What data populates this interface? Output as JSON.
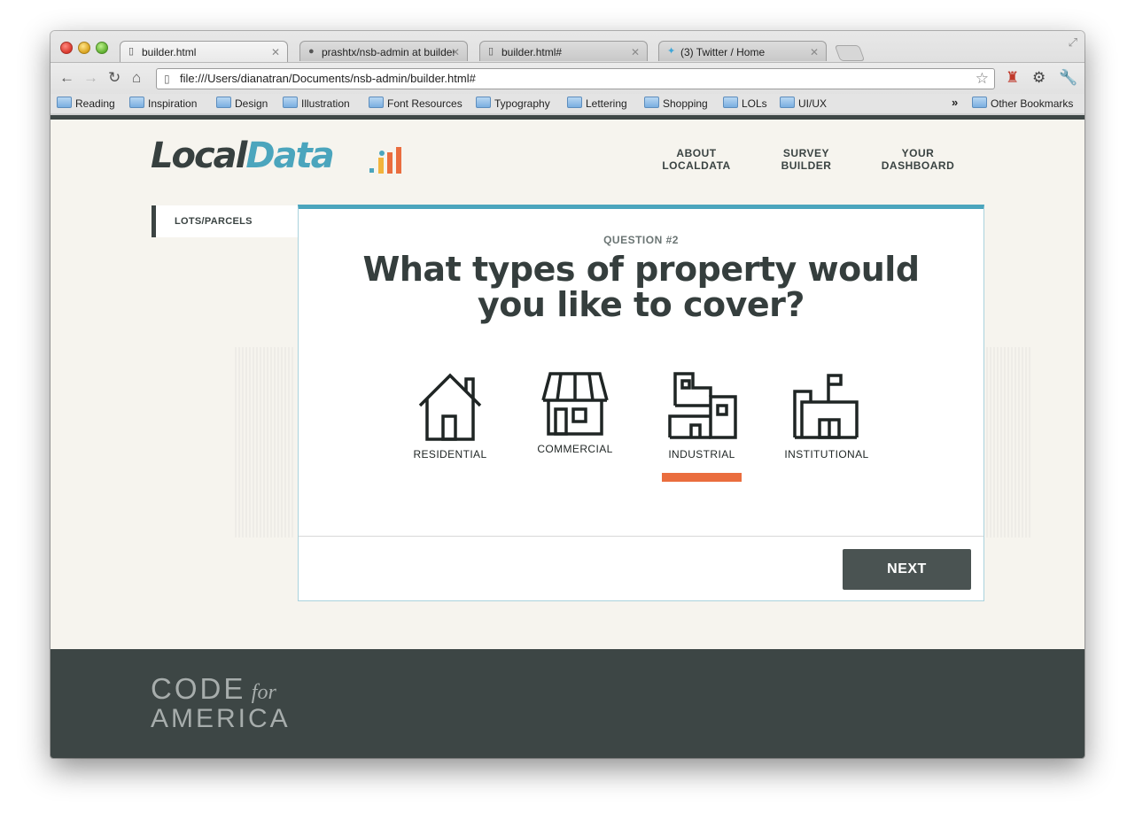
{
  "browser": {
    "tabs": [
      {
        "title": "builder.html",
        "icon": "page-icon"
      },
      {
        "title": "prashtx/nsb-admin at builder",
        "icon": "github-icon"
      },
      {
        "title": "builder.html#",
        "icon": "page-icon"
      },
      {
        "title": "(3) Twitter / Home",
        "icon": "twitter-icon"
      }
    ],
    "address": "file:///Users/dianatran/Documents/nsb-admin/builder.html#",
    "bookmarks": [
      "Reading",
      "Inspiration",
      "Design",
      "Illustration",
      "Font Resources",
      "Typography",
      "Lettering",
      "Shopping",
      "LOLs",
      "UI/UX"
    ],
    "other_bookmarks": "Other Bookmarks",
    "more": "»"
  },
  "site": {
    "logo": {
      "local": "Local",
      "data": "Data"
    },
    "nav": [
      {
        "line1": "ABOUT",
        "line2": "LOCALDATA"
      },
      {
        "line1": "SURVEY",
        "line2": "BUILDER"
      },
      {
        "line1": "YOUR",
        "line2": "DASHBOARD"
      }
    ],
    "sidebar_item": "LOTS/PARCELS"
  },
  "question": {
    "label": "QUESTION #2",
    "title": "What types of property would you like to cover?",
    "options": [
      {
        "label": "RESIDENTIAL",
        "icon": "house-icon",
        "selected": false
      },
      {
        "label": "COMMERCIAL",
        "icon": "storefront-icon",
        "selected": false
      },
      {
        "label": "INDUSTRIAL",
        "icon": "factory-icon",
        "selected": true
      },
      {
        "label": "INSTITUTIONAL",
        "icon": "institution-icon",
        "selected": false
      }
    ],
    "next": "NEXT"
  },
  "footer": {
    "code": "CODE",
    "for": "for",
    "america": "AMERICA"
  },
  "colors": {
    "accent": "#4ba5bd",
    "selected": "#ea6d3e",
    "dark": "#3d4645"
  }
}
